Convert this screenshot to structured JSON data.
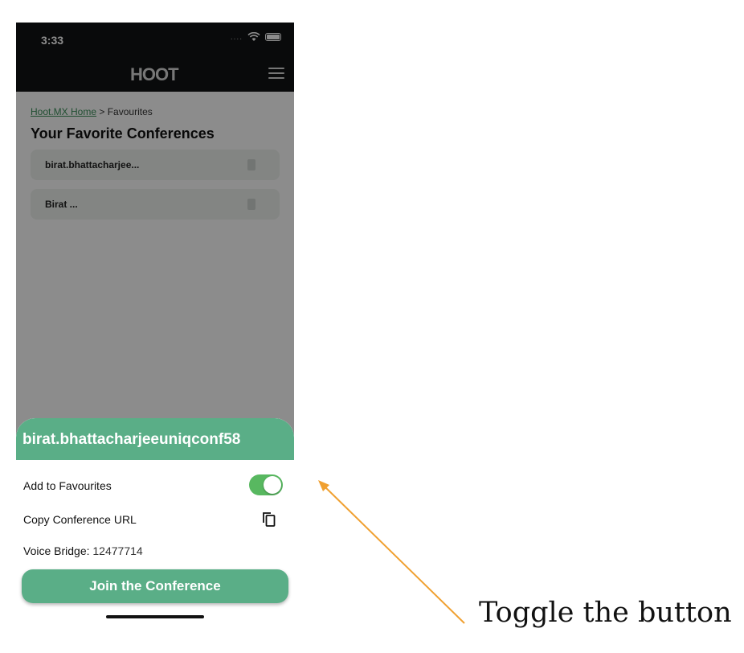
{
  "status_bar": {
    "time": "3:33"
  },
  "navbar": {
    "logo_text": "HOOT"
  },
  "breadcrumb": {
    "home": "Hoot.MX Home",
    "separator": " > ",
    "current": "Favourites"
  },
  "page": {
    "title": "Your Favorite Conferences"
  },
  "favorites": [
    {
      "name": "birat.bhattacharjee..."
    },
    {
      "name": "Birat ..."
    }
  ],
  "sheet": {
    "title": "birat.bhattacharjeeuniqconf58",
    "add_favourites_label": "Add to Favourites",
    "add_favourites_on": true,
    "copy_url_label": "Copy Conference URL",
    "voice_bridge_label": "Voice Bridge:",
    "voice_bridge_value": "12477714",
    "join_button": "Join the Conference"
  },
  "annotation": {
    "text": "Toggle the button"
  },
  "colors": {
    "accent": "#5aae87",
    "toggle_on": "#58b860",
    "arrow": "#f0a030"
  }
}
